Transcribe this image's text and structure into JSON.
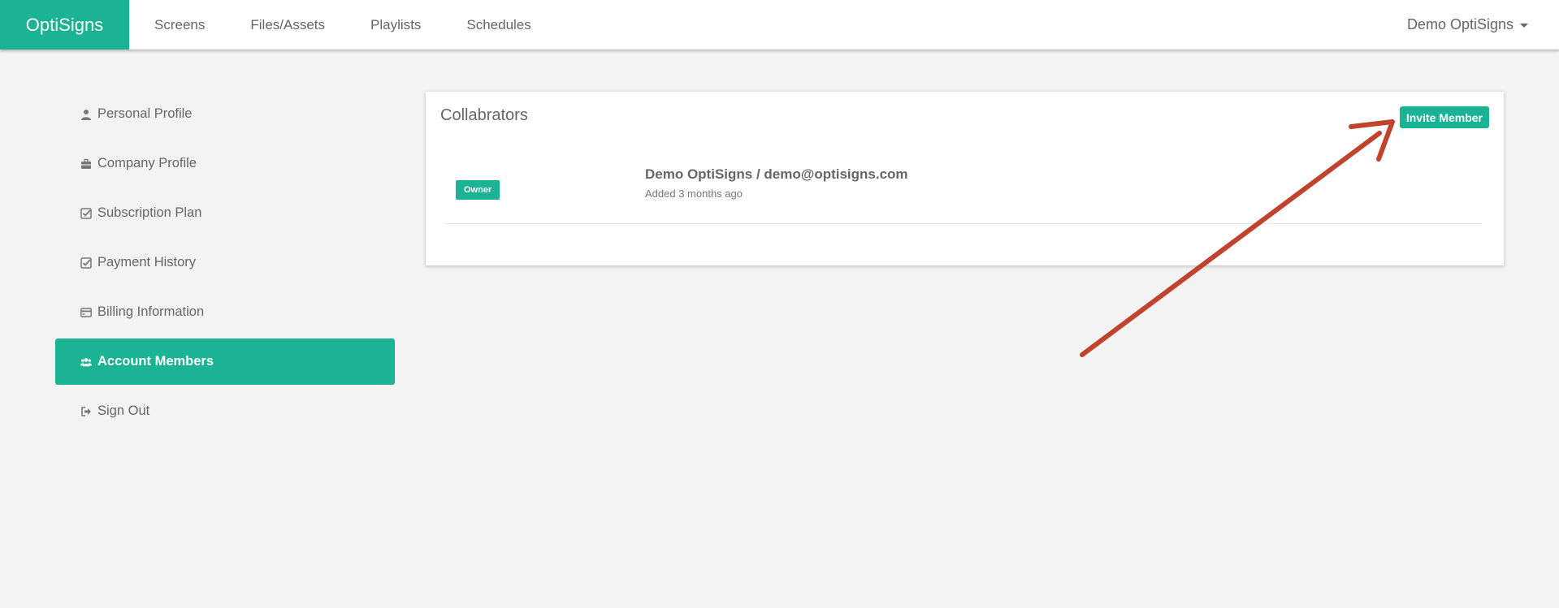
{
  "navbar": {
    "brand": "OptiSigns",
    "links": [
      "Screens",
      "Files/Assets",
      "Playlists",
      "Schedules"
    ],
    "user": "Demo OptiSigns"
  },
  "sidebar": {
    "items": [
      {
        "label": "Personal Profile",
        "icon": "user-icon"
      },
      {
        "label": "Company Profile",
        "icon": "briefcase-icon"
      },
      {
        "label": "Subscription Plan",
        "icon": "check-square-icon"
      },
      {
        "label": "Payment History",
        "icon": "check-square-icon"
      },
      {
        "label": "Billing Information",
        "icon": "credit-card-icon"
      },
      {
        "label": "Account Members",
        "icon": "users-icon"
      },
      {
        "label": "Sign Out",
        "icon": "sign-out-icon"
      }
    ],
    "active_index": 5
  },
  "card": {
    "title": "Collabrators",
    "invite_label": "Invite Member",
    "members": [
      {
        "role": "Owner",
        "name": "Demo OptiSigns / demo@optisigns.com",
        "added": "Added 3 months ago"
      }
    ]
  },
  "colors": {
    "accent": "#1ab394",
    "annotation_arrow": "#c0432e"
  }
}
